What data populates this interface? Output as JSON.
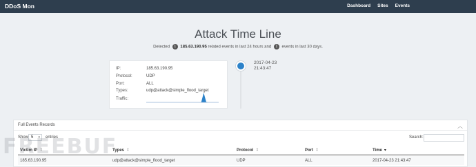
{
  "navbar": {
    "brand": "DDoS Mon",
    "links": [
      "Dashboard",
      "Sites",
      "Events"
    ]
  },
  "header": {
    "title": "Attack Time Line",
    "summary_prefix": "Detected",
    "count_24h": "1",
    "ip": "185.63.190.95",
    "summary_mid": "related events in last 24 hours and",
    "count_30d": "1",
    "summary_suffix": "events in last 30 days."
  },
  "event_card": {
    "ip_label": "IP:",
    "ip_value": "185.63.190.95",
    "protocol_label": "Protocol:",
    "protocol_value": "UDP",
    "port_label": "Port:",
    "port_value": "ALL",
    "types_label": "Types:",
    "types_value": "udp@attack@simple_flood_target",
    "traffic_label": "Traffic:",
    "traffic_series": [
      0.02,
      0.02,
      0.02,
      0.02,
      0.02,
      0.02,
      0.02,
      0.02,
      0.02,
      0.02,
      0.02,
      0.02,
      0.02,
      0.02,
      0.02,
      0.02,
      0.02,
      0.02,
      0.02,
      0.02,
      0.02,
      0.02,
      0.03,
      1.0,
      0.05,
      0.02,
      0.02,
      0.02,
      0.02,
      0.02
    ]
  },
  "timeline": {
    "date": "2017-04-23",
    "time": "21:43:47"
  },
  "records": {
    "panel_title": "Full Events Records",
    "show_label": "Show",
    "page_size": "5",
    "entries_label": "entries",
    "search_label": "Search:",
    "search_value": "",
    "columns": [
      "Victim IP",
      "Types",
      "Protocol",
      "Port",
      "Time"
    ],
    "rows": [
      [
        "185.63.190.95",
        "udp@attack@simple_flood_target",
        "UDP",
        "ALL",
        "2017-04-23 21:43:47"
      ]
    ]
  },
  "watermark": "FREEBUF",
  "colors": {
    "navbar": "#2e3e4e",
    "accent": "#2c82c9",
    "background": "#edf0f3"
  }
}
